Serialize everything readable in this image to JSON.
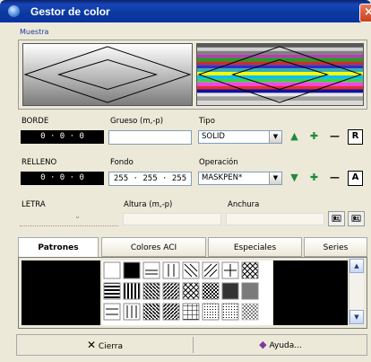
{
  "window": {
    "title": "Gestor de color",
    "close_icon": "close-icon"
  },
  "muestra": {
    "label": "Muestra"
  },
  "borde": {
    "label": "BORDE",
    "value": "0 · 0 · 0",
    "grueso_label": "Grueso (m,-p)",
    "grueso_value": "",
    "tipo_label": "Tipo",
    "tipo_value": "SOLID",
    "buttons": [
      "up-arrow",
      "plus",
      "minus",
      "R"
    ]
  },
  "relleno": {
    "label": "RELLENO",
    "value": "0 · 0 · 0",
    "fondo_label": "Fondo",
    "fondo_value": "255 · 255 · 255",
    "operacion_label": "Operación",
    "operacion_value": "MASKPEN*",
    "buttons": [
      "down-arrow",
      "plus",
      "minus",
      "A"
    ]
  },
  "letra": {
    "label": "LETRA",
    "altura_label": "Altura (m,-p)",
    "anchura_label": "Anchura"
  },
  "tabs": [
    {
      "label": "Patrones",
      "active": true
    },
    {
      "label": "Colores ACI",
      "active": false
    },
    {
      "label": "Especiales",
      "active": false
    },
    {
      "label": "Series",
      "active": false
    }
  ],
  "footer": {
    "cierra_label": "Cierra",
    "ayuda_label": "Ayuda..."
  },
  "colors": {
    "title_bar": "#0A3A9C",
    "face": "#ECE9D8",
    "link_blue": "#1A3AA0",
    "field_border": "#7F9DB9"
  }
}
